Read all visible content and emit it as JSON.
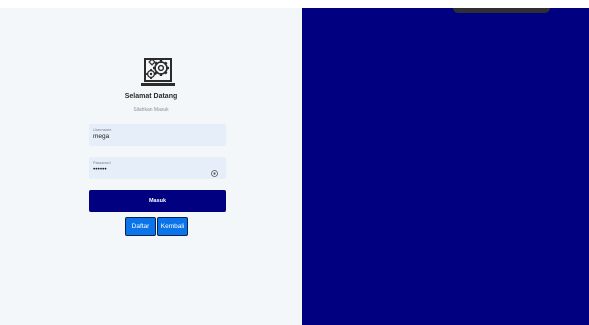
{
  "login": {
    "welcome": "Selamat Datang",
    "subtitle": "Silahkan Masuk",
    "username": {
      "label": "Username",
      "value": "mega"
    },
    "password": {
      "label": "Password",
      "value": "••••••"
    },
    "login_button": "Masuk",
    "register_button": "Daftar",
    "back_button": "Kembali"
  },
  "colors": {
    "left_panel": "#f4f7fa",
    "right_panel": "#000080",
    "primary_button": "#000080",
    "secondary_button": "#0b74ea",
    "input_background": "#e6eef9"
  },
  "icons": {
    "logo": "laptop-gears-icon",
    "password_toggle": "eye-icon"
  }
}
